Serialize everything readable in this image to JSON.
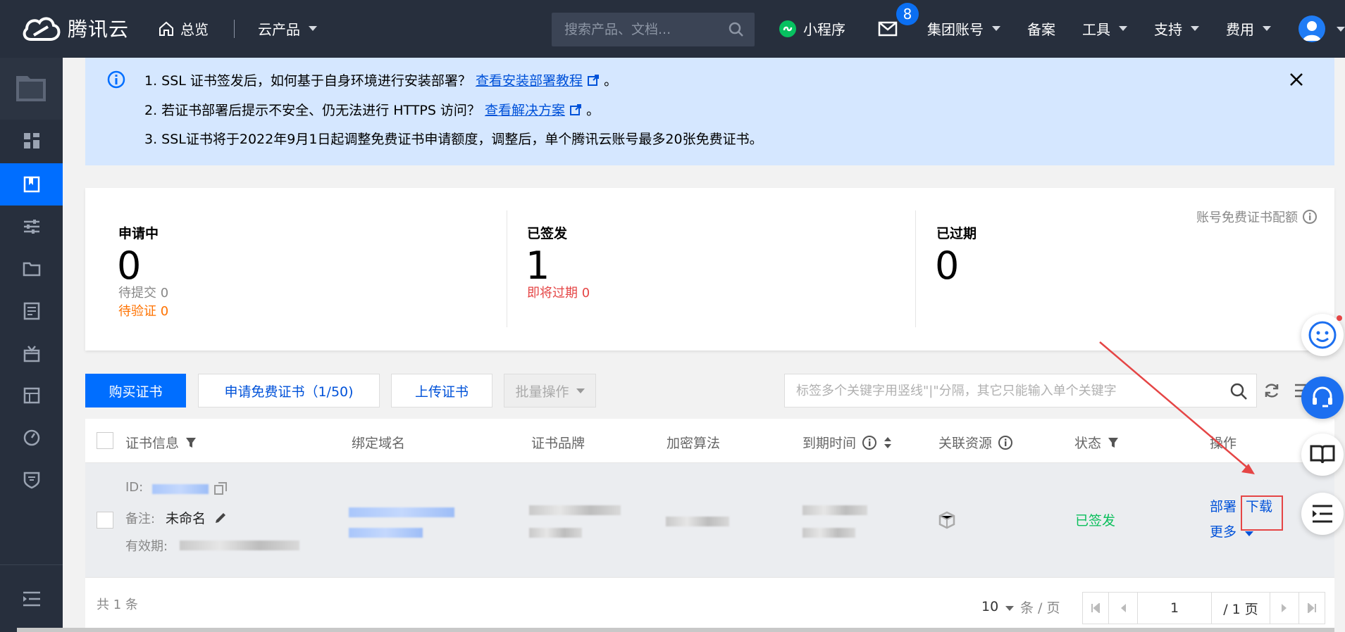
{
  "topnav": {
    "brand": "腾讯云",
    "overview": "总览",
    "products": "云产品",
    "search_placeholder": "搜索产品、文档...",
    "miniprogram": "小程序",
    "mail_badge": "8",
    "group_account": "集团账号",
    "filing": "备案",
    "tools": "工具",
    "support": "支持",
    "fees": "费用"
  },
  "notice": {
    "line1_text": "1. SSL 证书签发后，如何基于自身环境进行安装部署？",
    "line1_link": "查看安装部署教程",
    "line1_end": "。",
    "line2_text": "2. 若证书部署后提示不安全、仍无法进行 HTTPS 访问？",
    "line2_link": "查看解决方案",
    "line2_end": "。",
    "line3_text": "3. SSL证书将于2022年9月1日起调整免费证书申请额度，调整后，单个腾讯云账号最多20张免费证书。"
  },
  "stats": {
    "applying_title": "申请中",
    "applying_count": "0",
    "pending_submit": "待提交 0",
    "pending_verify": "待验证 0",
    "issued_title": "已签发",
    "issued_count": "1",
    "expiring_soon": "即将过期 0",
    "expired_title": "已过期",
    "expired_count": "0",
    "quota_label": "账号免费证书配额"
  },
  "toolbar": {
    "buy": "购买证书",
    "apply_free": "申请免费证书（1/50)",
    "upload": "上传证书",
    "batch": "批量操作",
    "filter_placeholder": "标签多个关键字用竖线\"|\"分隔，其它只能输入单个关键字"
  },
  "table": {
    "headers": {
      "info": "证书信息",
      "domain": "绑定域名",
      "brand": "证书品牌",
      "algo": "加密算法",
      "expiry": "到期时间",
      "resource": "关联资源",
      "status": "状态",
      "action": "操作"
    },
    "row": {
      "id_label": "ID:",
      "remark_label": "备注:",
      "remark_value": "未命名",
      "validity_label": "有效期:",
      "status": "已签发",
      "deploy": "部署",
      "download": "下载",
      "more": "更多"
    },
    "footer": {
      "total": "共 1 条",
      "page_size": "10",
      "per_page": "条 / 页",
      "page_input": "1",
      "page_total": "/ 1 页"
    }
  },
  "colors": {
    "accent": "#006eff",
    "nav_bg": "#272f3d",
    "issued_green": "#0abf5b",
    "warning_orange": "#ff7200",
    "danger_red": "#e54545"
  }
}
